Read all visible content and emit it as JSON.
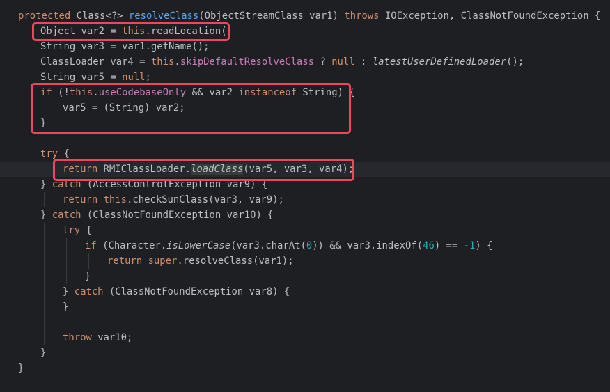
{
  "code": {
    "l1": {
      "t1": "protected",
      "t2": " Class<?> ",
      "t3": "resolveClass",
      "t4": "(ObjectStreamClass var1) ",
      "t5": "throws",
      "t6": " IOException, ClassNotFoundException {"
    },
    "l2": {
      "t1": "Object var2 = ",
      "t2": "this",
      "t3": ".readLocation()"
    },
    "l3": {
      "t1": "String var3 = var1.getName();"
    },
    "l4": {
      "t1": "ClassLoader var4 = ",
      "t2": "this",
      "t3": ".",
      "t4": "skipDefaultResolveClass",
      "t5": " ? ",
      "t6": "null",
      "t7": " : ",
      "t8": "latestUserDefinedLoader",
      "t9": "();"
    },
    "l5": {
      "t1": "String var5 = ",
      "t2": "null",
      "t3": ";"
    },
    "l6": {
      "t1": "if",
      "t2": " (!",
      "t3": "this",
      "t4": ".",
      "t5": "useCodebaseOnly",
      "t6": " && var2 ",
      "t7": "instanceof",
      "t8": " String) {"
    },
    "l7": {
      "t1": "var5 = (String) var2;"
    },
    "l8": {
      "t1": "}"
    },
    "l10": {
      "t1": "try",
      "t2": " {"
    },
    "l11": {
      "t1": "return",
      "t2": " RMIClassLoader.",
      "t3": "loadClass",
      "t4": "(var5, var3, var4);"
    },
    "l12": {
      "t1": "} ",
      "t2": "catch",
      "t3": " (AccessControlException var9) {"
    },
    "l13": {
      "t1": "return",
      "t2": " ",
      "t3": "this",
      "t4": ".checkSunClass(var3, var9);"
    },
    "l14": {
      "t1": "} ",
      "t2": "catch",
      "t3": " (ClassNotFoundException var10) {"
    },
    "l15": {
      "t1": "try",
      "t2": " {"
    },
    "l16": {
      "t1": "if",
      "t2": " (Character.",
      "t3": "isLowerCase",
      "t4": "(var3.charAt(",
      "t5": "0",
      "t6": ")) && var3.indexOf(",
      "t7": "46",
      "t8": ") == ",
      "t9": "-1",
      "t10": ") {"
    },
    "l17": {
      "t1": "return",
      "t2": " ",
      "t3": "super",
      "t4": ".resolveClass(var1);"
    },
    "l18": {
      "t1": "}"
    },
    "l19": {
      "t1": "} ",
      "t2": "catch",
      "t3": " (ClassNotFoundException var8) {"
    },
    "l20": {
      "t1": "}"
    },
    "l22": {
      "t1": "throw",
      "t2": " var10;"
    },
    "l23": {
      "t1": "}"
    },
    "l24": {
      "t1": "}"
    }
  },
  "colors": {
    "background": "#1e1f22",
    "current_line": "#26282e",
    "default_text": "#bcbec4",
    "keyword": "#cf8e6d",
    "method_declaration": "#56a8f5",
    "field": "#c77dba",
    "number": "#2aacb8",
    "annotation_box": "#f0455c"
  }
}
